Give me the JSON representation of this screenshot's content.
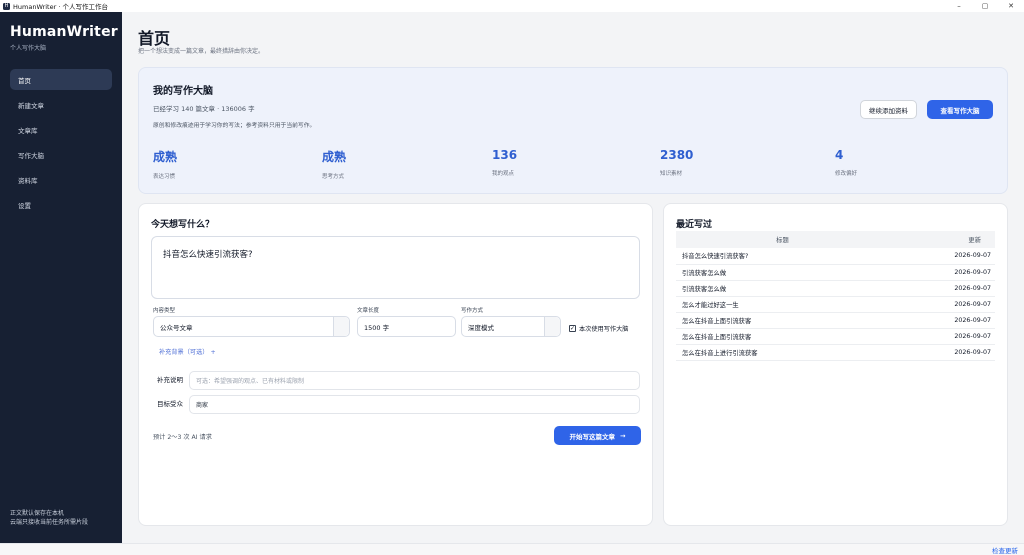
{
  "window": {
    "title": "HumanWriter · 个人写作工作台",
    "icon_glyph": "H",
    "controls": [
      "–",
      "▢",
      "✕"
    ]
  },
  "sidebar": {
    "brand_name": "HumanWriter",
    "brand_sub": "个人写作大脑",
    "items": [
      {
        "label": "首页",
        "active": true
      },
      {
        "label": "新建文章",
        "active": false
      },
      {
        "label": "文章库",
        "active": false
      },
      {
        "label": "写作大脑",
        "active": false
      },
      {
        "label": "资料库",
        "active": false
      },
      {
        "label": "设置",
        "active": false
      }
    ],
    "footer_line1": "正文默认保存在本机",
    "footer_line2": "云端只接收当前任务所需片段"
  },
  "header": {
    "title": "首页",
    "subtitle": "把一个想法变成一篇文章，最终措辞由你决定。"
  },
  "brain": {
    "title": "我的写作大脑",
    "meta": "已经学习 140 篇文章 · 136006 字",
    "desc": "原创和修改痕迹用于学习你的写法；参考资料只用于当前写作。",
    "add_button": "继续添加资料",
    "view_button": "查看写作大脑",
    "stats": [
      {
        "value": "成熟",
        "label": "表达习惯"
      },
      {
        "value": "成熟",
        "label": "思考方式"
      },
      {
        "value": "136",
        "label": "我的观点"
      },
      {
        "value": "2380",
        "label": "知识素材"
      },
      {
        "value": "4",
        "label": "修改偏好"
      }
    ]
  },
  "compose": {
    "question": "今天想写什么？",
    "topic": "抖音怎么快速引流获客?",
    "content_type_label": "内容类型",
    "content_type_value": "公众号文章",
    "length_label": "文章长度",
    "length_value": "1500 字",
    "mode_label": "写作方式",
    "mode_value": "深度模式",
    "use_brain_label": "本次使用写作大脑",
    "use_brain_checked": true,
    "extra_toggle": "补充背景（可选） +",
    "note_label": "补充说明",
    "note_placeholder": "可选：希望强调的观点、已有材料或限制",
    "audience_label": "目标受众",
    "audience_value": "商家",
    "estimate": "预计 2～3 次 AI 请求",
    "start_button": "开始写这篇文章",
    "start_arrow": "→"
  },
  "recent": {
    "title": "最近写过",
    "col_title": "标题",
    "col_date": "更新",
    "rows": [
      {
        "title": "抖音怎么快速引流获客?",
        "date": "2026-09-07"
      },
      {
        "title": "引流获客怎么做",
        "date": "2026-09-07"
      },
      {
        "title": "引流获客怎么做",
        "date": "2026-09-07"
      },
      {
        "title": "怎么才能过好这一生",
        "date": "2026-09-07"
      },
      {
        "title": "怎么在抖音上面引流获客",
        "date": "2026-09-07"
      },
      {
        "title": "怎么在抖音上面引流获客",
        "date": "2026-09-07"
      },
      {
        "title": "怎么在抖音上进行引流获客",
        "date": "2026-09-07"
      }
    ]
  },
  "statusbar": {
    "check_update": "检查更新"
  },
  "colors": {
    "sidebar_bg": "#172033",
    "accent": "#2f64e8",
    "stat_text": "#2f5fd0"
  }
}
